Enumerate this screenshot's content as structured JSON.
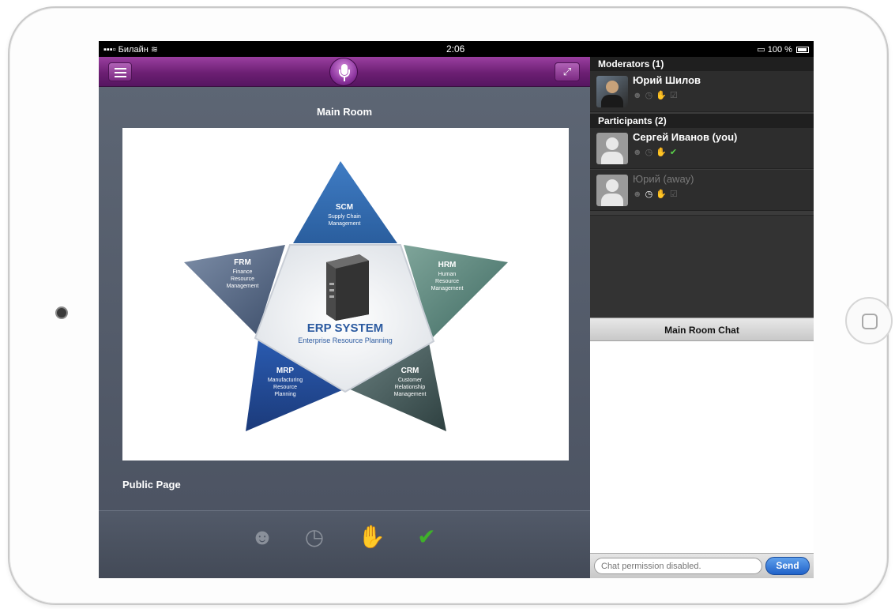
{
  "status_bar": {
    "carrier": "Билайн",
    "time": "2:06",
    "battery": "100 %"
  },
  "left_panel": {
    "room_title": "Main Room",
    "page_label": "Public Page",
    "slide": {
      "center_title": "ERP SYSTEM",
      "center_subtitle": "Enterprise Resource Planning",
      "points": [
        {
          "abbr": "SCM",
          "lines": [
            "Supply Chain",
            "Management"
          ]
        },
        {
          "abbr": "HRM",
          "lines": [
            "Human",
            "Resource",
            "Management"
          ]
        },
        {
          "abbr": "CRM",
          "lines": [
            "Customer",
            "Relationship",
            "Management"
          ]
        },
        {
          "abbr": "MRP",
          "lines": [
            "Manufacturing",
            "Resource",
            "Planning"
          ]
        },
        {
          "abbr": "FRM",
          "lines": [
            "Finance",
            "Resource",
            "Management"
          ]
        }
      ]
    }
  },
  "right_panel": {
    "moderators_header": "Moderators (1)",
    "participants_header": "Participants (2)",
    "moderator": {
      "name": "Юрий Шилов"
    },
    "participants": [
      {
        "name": "Сергей Иванов (you)"
      },
      {
        "name": "Юрий  (away)"
      }
    ],
    "chat_title": "Main Room Chat",
    "chat_placeholder": "Chat permission disabled.",
    "send_label": "Send"
  },
  "colors": {
    "toolbar_purple": "#6c1f73",
    "accent_blue": "#2062c9",
    "ok_green": "#3fb02a"
  }
}
